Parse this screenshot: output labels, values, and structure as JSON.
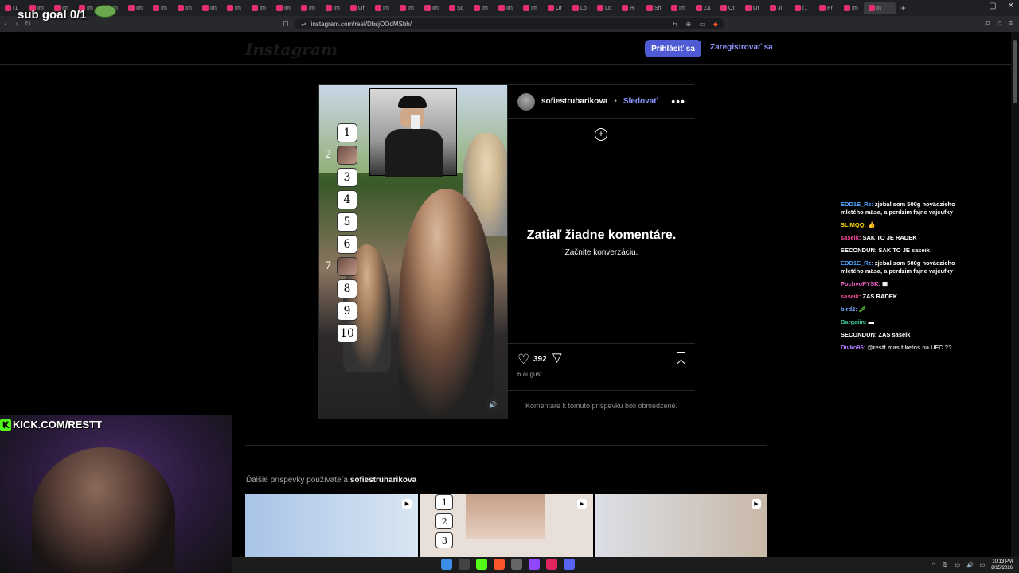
{
  "browser": {
    "tabs": [
      "(1",
      "Im",
      "Im",
      "Im",
      "Im",
      "Im",
      "Im",
      "Im",
      "Im",
      "Im",
      "Im",
      "Im",
      "Im",
      "Im",
      "Oh",
      "Im",
      "Im",
      "Im",
      "Sc",
      "Im",
      "Im",
      "Im",
      "Or",
      "Lo",
      "Lo",
      "Hi",
      "Sh",
      "Im",
      "Za",
      "Ot",
      "Ot",
      "Ji",
      "(1",
      "Pr",
      "Im",
      "In"
    ],
    "active_tab": "In",
    "url": "instagram.com/reel/DbsjOOdMSbh/"
  },
  "stream": {
    "sub_goal": "sub goal 0/1",
    "kick": "KICK.COM/RESTT"
  },
  "instagram": {
    "logo": "Instagram",
    "login_label": "Prihlásiť sa",
    "register_label": "Zaregistrovať sa",
    "post": {
      "username": "sofiestruharikova",
      "dot": "•",
      "follow_label": "Sledovať",
      "no_comments": "Zatiaľ žiadne komentáre.",
      "start_conversation": "Začnite konverzáciu.",
      "likes": "392",
      "date": "6 august",
      "comments_limited": "Komentáre k tomuto príspevku boli obmedzené.",
      "ranks": [
        "1",
        "",
        "3",
        "4",
        "5",
        "6",
        "",
        "8",
        "9",
        "10"
      ],
      "rank_side_2": "2",
      "rank_side_7": "7"
    },
    "more_posts_prefix": "Ďalšie príspevky používateľa",
    "more_posts_user": "sofiestruharikova",
    "mini_ranks": [
      "1",
      "2",
      "3"
    ]
  },
  "chat": [
    {
      "user": "EDD1E_Rz:",
      "text": "zjebal som 500g hovädzieho mletého mäsa, a perdzim fajne vajcufky",
      "color": "#4aa3ff"
    },
    {
      "user": "SLIMQQ:",
      "text": "👍",
      "color": "#ffd700"
    },
    {
      "user": "saseik:",
      "text": "SAK TO JE RADEK",
      "color": "#ff4fa3"
    },
    {
      "user": "SECONDUN:",
      "text": "SAK TO JE saseik",
      "color": "#ffffff"
    },
    {
      "user": "EDD1E_Rz:",
      "text": "zjebal som 500g hovädzieho mletého mäsa, a perdzim fajne vajcufky",
      "color": "#4aa3ff"
    },
    {
      "user": "PochvoPYSK:",
      "text": "▦",
      "color": "#ff66cc"
    },
    {
      "user": "saseik:",
      "text": "ZAS RADEK",
      "color": "#ff4fa3"
    },
    {
      "user": "bird2:",
      "text": "🥒",
      "color": "#7aa8ff"
    },
    {
      "user": "Bargaiin:",
      "text": "▬",
      "color": "#3cd0a0"
    },
    {
      "user": "SECONDUN:",
      "text": "ZAS saseik",
      "color": "#ffffff"
    },
    {
      "user": "Divko96:",
      "text": "@restt mas tiketos na UFC ??",
      "color": "#b07cff",
      "mute": true
    }
  ],
  "taskbar": {
    "time": "10:13 PM",
    "date": "8/15/2026"
  }
}
